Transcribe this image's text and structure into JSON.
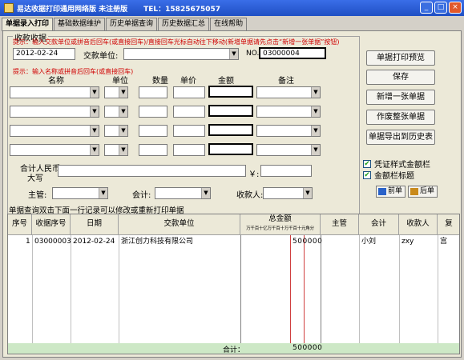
{
  "window": {
    "title": "易达收据打印通用网络版 未注册版",
    "phone": "TEL：15825675057",
    "buttons": [
      "_",
      "□",
      "×"
    ]
  },
  "tabs": [
    "单据录入打印",
    "基础数据维护",
    "历史单据查询",
    "历史数据汇总",
    "在线帮助"
  ],
  "form": {
    "group_title": "收款收据",
    "hint1": "提示：输入交款单位或拼音后回车(或直接回车)/直接回车光标自动往下移动(新增单据请先点击“新增一张单据”按钮)",
    "date": "2012-02-24",
    "payer_label": "交款单位:",
    "no_label": "NO.",
    "no_value": "03000004",
    "hint2": "提示：输入名称或拼音后回车(或直接回车)",
    "col_name": "名称",
    "col_unit": "单位",
    "col_qty": "数量",
    "col_price": "单价",
    "col_amount": "金额",
    "col_remark": "备注",
    "total_label_line1": "合计人民币",
    "total_label_line2": "大写",
    "yen": "￥:",
    "supervisor_label": "主管:",
    "accountant_label": "会计:",
    "payee_label": "收款人:"
  },
  "buttons": {
    "preview": "单据打印预览",
    "save": "保存",
    "new": "新增一张单据",
    "void": "作废整张单据",
    "export": "单据导出到历史表"
  },
  "checks": {
    "voucher_style": "凭证样式金额栏",
    "amount_title": "金额栏标题"
  },
  "nav": {
    "prev": "前单",
    "next": "后单"
  },
  "grid": {
    "title": "单据查询双击下面一行记录可以修改或重新打印单据",
    "headers": [
      "序号",
      "收据序号",
      "日期",
      "交款单位",
      "总金额",
      "主管",
      "会计",
      "收款人",
      "复"
    ],
    "amount_subheader": "万千百十亿万千百十万千百十元角分",
    "rows": [
      {
        "seq": "1",
        "receipt_no": "03000003",
        "date": "2012-02-24",
        "payer": "浙江创力科技有限公司",
        "amount": "500000",
        "supervisor": "",
        "accountant": "小刘",
        "payee": "zxy",
        "extra": "宫"
      }
    ],
    "total_label": "合计：",
    "total_amount": "500000"
  }
}
